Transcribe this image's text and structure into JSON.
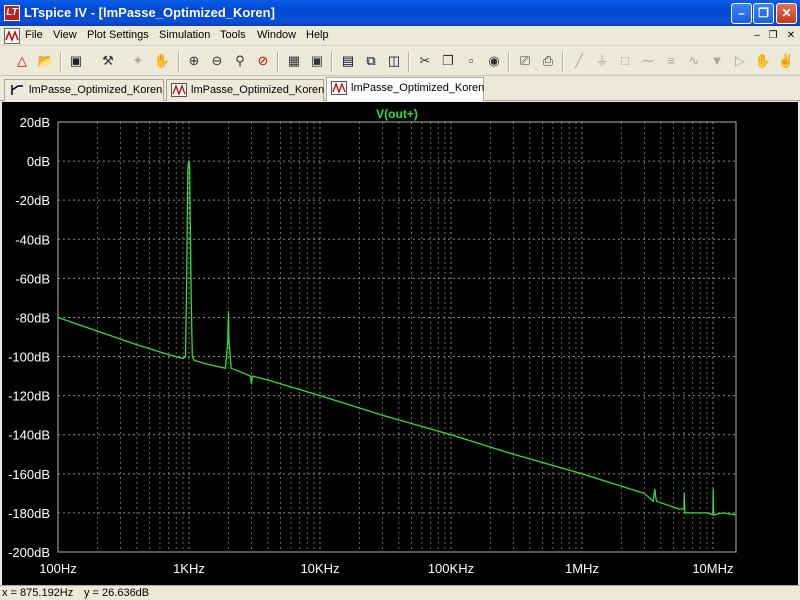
{
  "window": {
    "title": "LTspice IV - [lmPasse_Optimized_Koren]",
    "logo_text": "LT"
  },
  "menu": [
    "File",
    "View",
    "Plot Settings",
    "Simulation",
    "Tools",
    "Window",
    "Help"
  ],
  "tabs": [
    {
      "label": "lmPasse_Optimized_Koren",
      "icon": "schematic-icon",
      "active": false
    },
    {
      "label": "lmPasse_Optimized_Koren",
      "icon": "waveform-icon",
      "active": false
    },
    {
      "label": "lmPasse_Optimized_Koren",
      "icon": "waveform-icon",
      "active": true
    }
  ],
  "toolbar_icons": [
    "run-icon",
    "open-icon",
    "save-icon",
    "control-panel-icon",
    "halt-icon",
    "pan-icon",
    "zoom-in-icon",
    "zoom-out-icon",
    "zoom-area-icon",
    "zoom-cancel-icon",
    "autorange-icon",
    "fit-icon",
    "tile-horizontal-icon",
    "cascade-icon",
    "tile-icon",
    "cut-icon",
    "copy-icon",
    "paste-icon",
    "find-icon",
    "print-setup-icon",
    "print-icon",
    "wire-icon",
    "ground-icon",
    "label-icon",
    "resistor-icon",
    "capacitor-icon",
    "inductor-icon",
    "diode-icon",
    "component-icon",
    "move-icon"
  ],
  "status": {
    "x_readout": "x = 875.192Hz",
    "y_readout": "y = 26.636dB"
  },
  "colors": {
    "trace": "#33dd33",
    "grid": "#8a8a8a",
    "background": "#000000",
    "title_bar": "#0a5ee8"
  },
  "chart_data": {
    "type": "line",
    "title": "V(out+)",
    "xlabel": "",
    "ylabel": "",
    "x_scale": "log",
    "xlim": [
      100,
      15000000
    ],
    "ylim": [
      -200,
      20
    ],
    "x_ticks": [
      100,
      1000,
      10000,
      100000,
      1000000,
      10000000
    ],
    "x_tick_labels": [
      "100Hz",
      "1KHz",
      "10KHz",
      "100KHz",
      "1MHz",
      "10MHz"
    ],
    "y_ticks": [
      20,
      0,
      -20,
      -40,
      -60,
      -80,
      -100,
      -120,
      -140,
      -160,
      -180,
      -200
    ],
    "y_tick_labels": [
      "20dB",
      "0dB",
      "-20dB",
      "-40dB",
      "-60dB",
      "-80dB",
      "-100dB",
      "-120dB",
      "-140dB",
      "-160dB",
      "-180dB",
      "-200dB"
    ],
    "grid": true,
    "series": [
      {
        "name": "V(out+)",
        "x": [
          100,
          200,
          400,
          700,
          900,
          940,
          960,
          980,
          990,
          1000,
          1010,
          1020,
          1040,
          1060,
          1100,
          1400,
          1900,
          1980,
          2000,
          2020,
          2100,
          2500,
          2950,
          3000,
          3050,
          4000,
          10000,
          30000,
          100000,
          300000,
          1000000,
          3000000,
          3500000,
          3600000,
          3700000,
          5500000,
          6000000,
          6050000,
          6100000,
          9000000,
          10000000,
          10050000,
          10100000,
          12000000,
          15000000
        ],
        "y": [
          -80,
          -87,
          -94,
          -99,
          -101,
          -100,
          -60,
          -5,
          -1,
          0,
          -2,
          -25,
          -70,
          -100,
          -102,
          -104,
          -106,
          -92,
          -77,
          -92,
          -106,
          -108,
          -110,
          -114,
          -110,
          -112,
          -120,
          -130,
          -140,
          -150,
          -160,
          -170,
          -174,
          -168,
          -174,
          -178,
          -178,
          -170,
          -180,
          -180,
          -181,
          -168,
          -181,
          -180,
          -181
        ]
      }
    ]
  }
}
